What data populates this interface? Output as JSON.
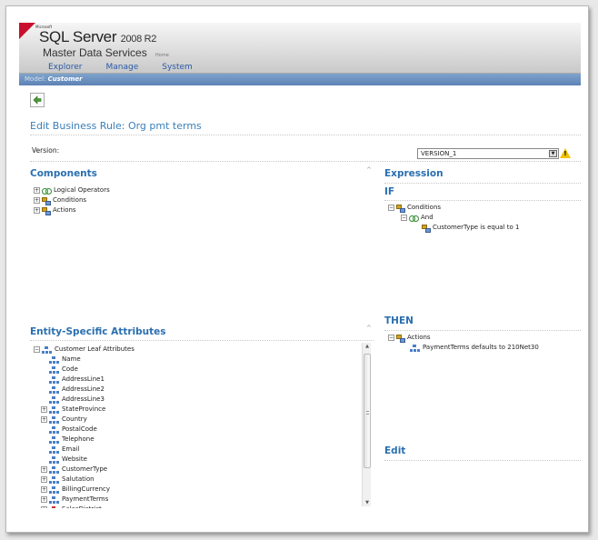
{
  "header": {
    "microsoft_text": "Microsoft",
    "product_name": "SQL Server",
    "product_version": "2008 R2",
    "product_subtitle": "Master Data Services",
    "home_link": "Home",
    "nav": [
      "Explorer",
      "Manage",
      "System"
    ]
  },
  "model_bar": {
    "label": "Model:",
    "model_name": "Customer"
  },
  "page": {
    "title": "Edit Business Rule: Org pmt terms"
  },
  "version": {
    "label": "Version:",
    "selected": "VERSION_1"
  },
  "components": {
    "title": "Components",
    "items": [
      "Logical Operators",
      "Conditions",
      "Actions"
    ]
  },
  "expression": {
    "title": "Expression",
    "if_title": "IF",
    "conditions_label": "Conditions",
    "and_label": "And",
    "condition_text": "CustomerType is equal to 1",
    "then_title": "THEN",
    "actions_label": "Actions",
    "action_text": "PaymentTerms defaults to 210Net30",
    "edit_title": "Edit"
  },
  "entity_attributes": {
    "title": "Entity-Specific Attributes",
    "root_label": "Customer Leaf Attributes",
    "items": [
      {
        "label": "Name",
        "expandable": false
      },
      {
        "label": "Code",
        "expandable": false
      },
      {
        "label": "AddressLine1",
        "expandable": false
      },
      {
        "label": "AddressLine2",
        "expandable": false
      },
      {
        "label": "AddressLine3",
        "expandable": false
      },
      {
        "label": "StateProvince",
        "expandable": true
      },
      {
        "label": "Country",
        "expandable": true
      },
      {
        "label": "PostalCode",
        "expandable": false
      },
      {
        "label": "Telephone",
        "expandable": false
      },
      {
        "label": "Email",
        "expandable": false
      },
      {
        "label": "Website",
        "expandable": false
      },
      {
        "label": "CustomerType",
        "expandable": true
      },
      {
        "label": "Salutation",
        "expandable": true
      },
      {
        "label": "BillingCurrency",
        "expandable": true
      },
      {
        "label": "PaymentTerms",
        "expandable": true
      },
      {
        "label": "SalesDistrict",
        "expandable": true
      }
    ]
  }
}
